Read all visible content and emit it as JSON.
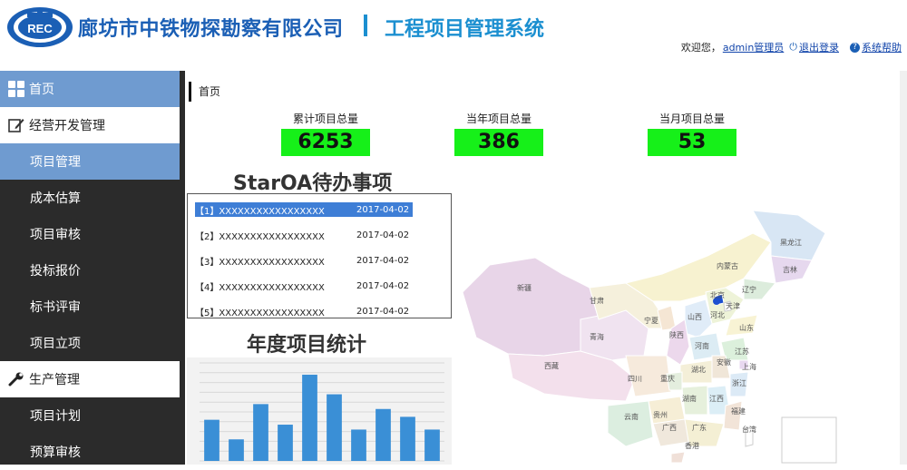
{
  "header": {
    "company": "廊坊市中铁物探勘察有限公司",
    "separator": "|",
    "system": "工程项目管理系统",
    "logo_text": "REC",
    "welcome": "欢迎您，",
    "user": "admin管理员",
    "logout": "退出登录",
    "help": "系统帮助"
  },
  "sidebar": {
    "home": "首页",
    "groups": [
      {
        "label": "经营开发管理",
        "icon": "edit-icon",
        "items": [
          "项目管理",
          "成本估算",
          "项目审核",
          "投标报价",
          "标书评审",
          "项目立项"
        ]
      },
      {
        "label": "生产管理",
        "icon": "wrench-icon",
        "items": [
          "项目计划",
          "预算审核"
        ]
      }
    ],
    "active_item": "项目管理"
  },
  "breadcrumb": "首页",
  "stats": [
    {
      "label": "累计项目总量",
      "value": "6253"
    },
    {
      "label": "当年项目总量",
      "value": "386"
    },
    {
      "label": "当月项目总量",
      "value": "53"
    }
  ],
  "stat_color": "#16f019",
  "todo": {
    "title": "StarOA待办事项",
    "rows": [
      {
        "text": "【1】XXXXXXXXXXXXXXXXX",
        "date": "2017-04-02"
      },
      {
        "text": "【2】XXXXXXXXXXXXXXXXX",
        "date": "2017-04-02"
      },
      {
        "text": "【3】XXXXXXXXXXXXXXXXX",
        "date": "2017-04-02"
      },
      {
        "text": "【4】XXXXXXXXXXXXXXXXX",
        "date": "2017-04-02"
      },
      {
        "text": "【5】XXXXXXXXXXXXXXXXX",
        "date": "2017-04-02"
      }
    ]
  },
  "yearly": {
    "title": "年度项目统计",
    "chart_data": {
      "type": "bar",
      "values": [
        210,
        110,
        290,
        185,
        440,
        340,
        160,
        265,
        225,
        160
      ],
      "ylim": [
        0,
        500
      ],
      "color": "#3a8fd6"
    }
  },
  "map": {
    "regions": [
      "黑龙江",
      "吉林",
      "辽宁",
      "内蒙古",
      "北京",
      "天津",
      "河北",
      "山西",
      "山东",
      "新疆",
      "甘肃",
      "宁夏",
      "陕西",
      "河南",
      "青海",
      "江苏",
      "安徽",
      "上海",
      "湖北",
      "西藏",
      "四川",
      "重庆",
      "浙江",
      "湖南",
      "江西",
      "贵州",
      "福建",
      "云南",
      "广西",
      "广东",
      "台湾",
      "香港"
    ]
  }
}
